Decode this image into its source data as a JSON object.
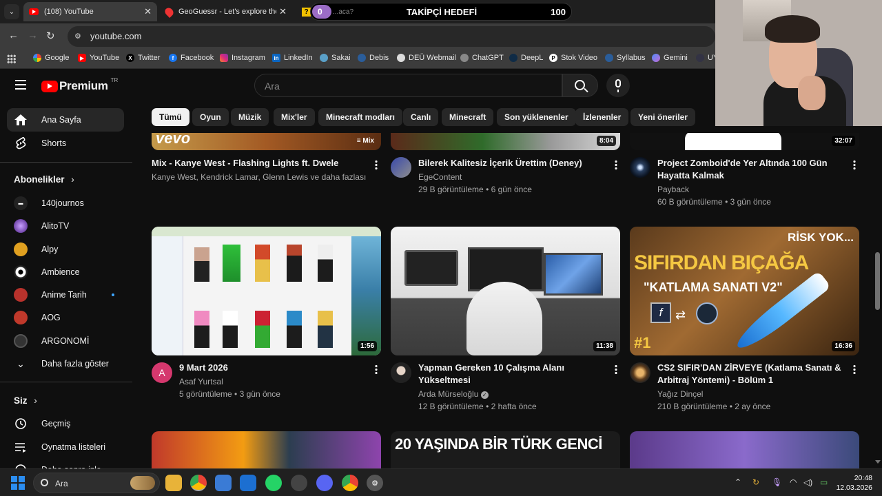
{
  "browser": {
    "tabs": [
      {
        "title": "(108) YouTube",
        "close": "✕"
      },
      {
        "title": "GeoGuessr - Let's explore the w",
        "close": "✕"
      },
      {
        "title": "...aca?"
      }
    ],
    "goal_overlay": {
      "current": "0",
      "title": "TAKİPÇİ HEDEFİ",
      "target": "100"
    },
    "url": "youtube.com",
    "bookmarks": [
      "Google",
      "YouTube",
      "Twitter",
      "Facebook",
      "Instagram",
      "LinkedIn",
      "Sakai",
      "Debis",
      "DEÜ Webmail",
      "ChatGPT",
      "DeepL",
      "Stok Video",
      "Syllabus",
      "Gemini",
      "UY"
    ]
  },
  "masthead": {
    "logo_text": "Premium",
    "country": "TR",
    "search_placeholder": "Ara"
  },
  "sidebar": {
    "main": [
      {
        "label": "Ana Sayfa",
        "icon": "home-icon",
        "active": true
      },
      {
        "label": "Shorts",
        "icon": "shorts-icon"
      }
    ],
    "subs_header": "Abonelikler",
    "subscriptions": [
      {
        "label": "140journos",
        "color": "#222222"
      },
      {
        "label": "AlitoTV",
        "color": "#7a3fb5"
      },
      {
        "label": "Alpy",
        "color": "#e0a020"
      },
      {
        "label": "Ambience",
        "color": "#ffffff"
      },
      {
        "label": "Anime Tarih",
        "color": "#b8322c",
        "live": true
      },
      {
        "label": "AOG",
        "color": "#c0392b"
      },
      {
        "label": "ARGONOMİ",
        "color": "#333333"
      }
    ],
    "show_more": "Daha fazla göster",
    "you_header": "Siz",
    "you_items": [
      {
        "label": "Geçmiş",
        "icon": "history-icon"
      },
      {
        "label": "Oynatma listeleri",
        "icon": "playlists-icon"
      },
      {
        "label": "Daha sonra izle",
        "icon": "watch-later-icon"
      }
    ]
  },
  "chips": [
    "Tümü",
    "Oyun",
    "Müzik",
    "Mix'ler",
    "Minecraft modları",
    "Canlı",
    "Minecraft",
    "Son yüklenenler",
    "İzlenenler",
    "Yeni öneriler"
  ],
  "videos_top": [
    {
      "title": "Mix - Kanye West - Flashing Lights ft. Dwele",
      "channel": "Kanye West, Kendrick Lamar, Glenn Lewis ve daha fazlası",
      "meta": "",
      "badge": "Mix",
      "thumb_text": "vevo"
    },
    {
      "title": "Bilerek Kalitesiz İçerik Ürettim (Deney)",
      "channel": "EgeContent",
      "meta": "29 B görüntüleme • 6 gün önce",
      "duration": "8:04"
    },
    {
      "title": "Project Zomboid'de Yer Altında 100 Gün Hayatta Kalmak",
      "channel": "Payback",
      "meta": "60 B görüntüleme • 3 gün önce",
      "duration": "32:07"
    }
  ],
  "videos_mid": [
    {
      "title": "9 Mart 2026",
      "channel": "Asaf Yurtsal",
      "meta": "5 görüntüleme • 3 gün önce",
      "duration": "1:56",
      "avatar_letter": "A"
    },
    {
      "title": "Yapman Gereken 10 Çalışma Alanı Yükseltmesi",
      "channel": "Arda Mürseloğlu",
      "verified": true,
      "meta": "12 B görüntüleme • 2 hafta önce",
      "duration": "11:38"
    },
    {
      "title": "CS2 SIFIR'DAN ZİRVEYE (Katlama Sanatı & Arbitraj Yöntemi) - Bölüm 1",
      "channel": "Yağız Dinçel",
      "meta": "210 B görüntüleme • 2 ay önce",
      "duration": "16:36",
      "thumb_text": {
        "corner": "RİSK YOK...",
        "headline": "SIFIRDAN BIÇAĞA",
        "sub": "\"KATLAMA SANATI V2\"",
        "num": "#1"
      }
    }
  ],
  "videos_bottom": [
    {
      "thumb_text": ""
    },
    {
      "thumb_text": "20 YAŞINDA BİR TÜRK GENCİ"
    },
    {
      "thumb_text": ""
    }
  ],
  "taskbar": {
    "search_placeholder": "Ara",
    "time": "20:48",
    "date": "12.03.2026"
  }
}
